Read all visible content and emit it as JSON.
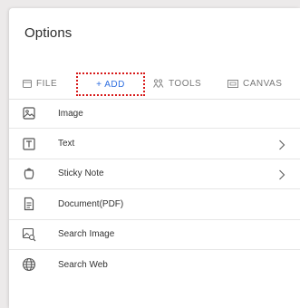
{
  "panel": {
    "title": "Options"
  },
  "tabs": [
    {
      "label": "FILE",
      "icon": "file-icon"
    },
    {
      "label": "+ ADD",
      "icon": "",
      "active": true
    },
    {
      "label": "TOOLS",
      "icon": "tools-icon"
    },
    {
      "label": "CANVAS",
      "icon": "canvas-icon"
    }
  ],
  "items": [
    {
      "label": "Image",
      "icon": "image-icon",
      "has_submenu": false
    },
    {
      "label": "Text",
      "icon": "text-box-icon",
      "has_submenu": true
    },
    {
      "label": "Sticky Note",
      "icon": "sticky-note-icon",
      "has_submenu": true
    },
    {
      "label": "Document(PDF)",
      "icon": "document-icon",
      "has_submenu": false
    },
    {
      "label": "Search Image",
      "icon": "search-image-icon",
      "has_submenu": false
    },
    {
      "label": "Search Web",
      "icon": "globe-icon",
      "has_submenu": false
    }
  ],
  "colors": {
    "accent": "#2f6fe0",
    "highlight_border": "#d81b1b",
    "background": "#eceaea"
  }
}
